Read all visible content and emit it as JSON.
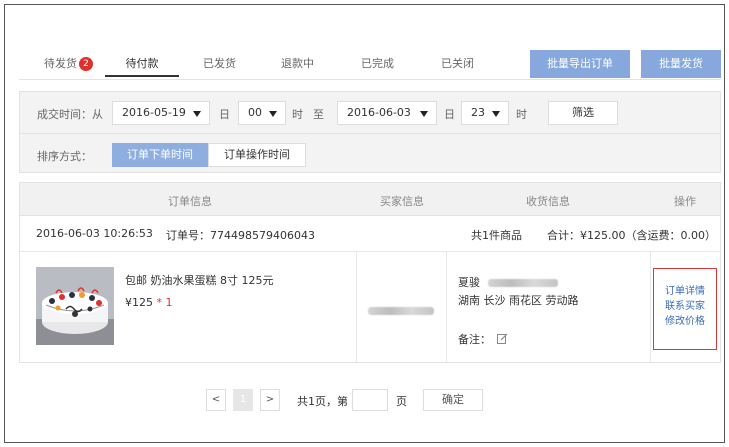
{
  "tabs": [
    {
      "label": "待发货",
      "badge": "2"
    },
    {
      "label": "待付款"
    },
    {
      "label": "已发货"
    },
    {
      "label": "退款中"
    },
    {
      "label": "已完成"
    },
    {
      "label": "已关闭"
    }
  ],
  "actions": {
    "export": "批量导出订单",
    "ship": "批量发货"
  },
  "filter": {
    "label": "成交时间：从",
    "from_date": "2016-05-19",
    "day1": "日",
    "from_hour": "00",
    "hour1": "时",
    "to": "至",
    "to_date": "2016-06-03",
    "day2": "日",
    "to_hour": "23",
    "hour2": "时",
    "button": "筛选"
  },
  "sort": {
    "label": "排序方式：",
    "options": [
      "订单下单时间",
      "订单操作时间"
    ],
    "selected": 0
  },
  "table": {
    "headers": [
      "订单信息",
      "买家信息",
      "收货信息",
      "操作"
    ]
  },
  "order": {
    "time": "2016-06-03 10:26:53",
    "number": "订单号：774498579406043",
    "count": "共1件商品",
    "total": "合计：¥125.00（含运费：0.00）",
    "product": {
      "title": "包邮 奶油水果蛋糕 8寸 125元",
      "price": "¥125",
      "qty": "* 1"
    },
    "receiver": {
      "name": "夏骏",
      "address": "湖南 长沙 雨花区 劳动路",
      "note": "备注："
    },
    "ops": [
      "订单详情",
      "联系买家",
      "修改价格"
    ]
  },
  "pagination": {
    "prev": "<",
    "page": "1",
    "next": ">",
    "info": "共1页，第",
    "suffix": "页",
    "confirm": "确定"
  },
  "icons": {
    "edit": "edit-icon",
    "cake": "cake-image"
  }
}
